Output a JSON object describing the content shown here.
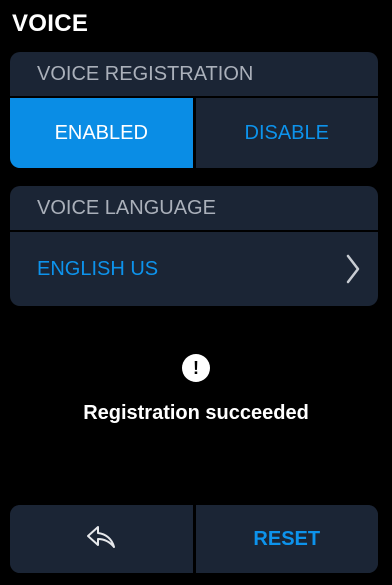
{
  "page_title": "VOICE",
  "voice_registration": {
    "header": "VOICE REGISTRATION",
    "options": [
      "ENABLED",
      "DISABLE"
    ],
    "selected": "ENABLED"
  },
  "voice_language": {
    "header": "VOICE LANGUAGE",
    "value": "ENGLISH US"
  },
  "message": {
    "icon": "exclamation-icon",
    "text": "Registration succeeded"
  },
  "bottom_bar": {
    "back_icon": "back-arrow-icon",
    "reset_label": "RESET"
  },
  "colors": {
    "background": "#000000",
    "card": "#1b2535",
    "accent": "#0a8de5",
    "accent_text": "#0d93ec",
    "header_text": "#aab0ba"
  }
}
